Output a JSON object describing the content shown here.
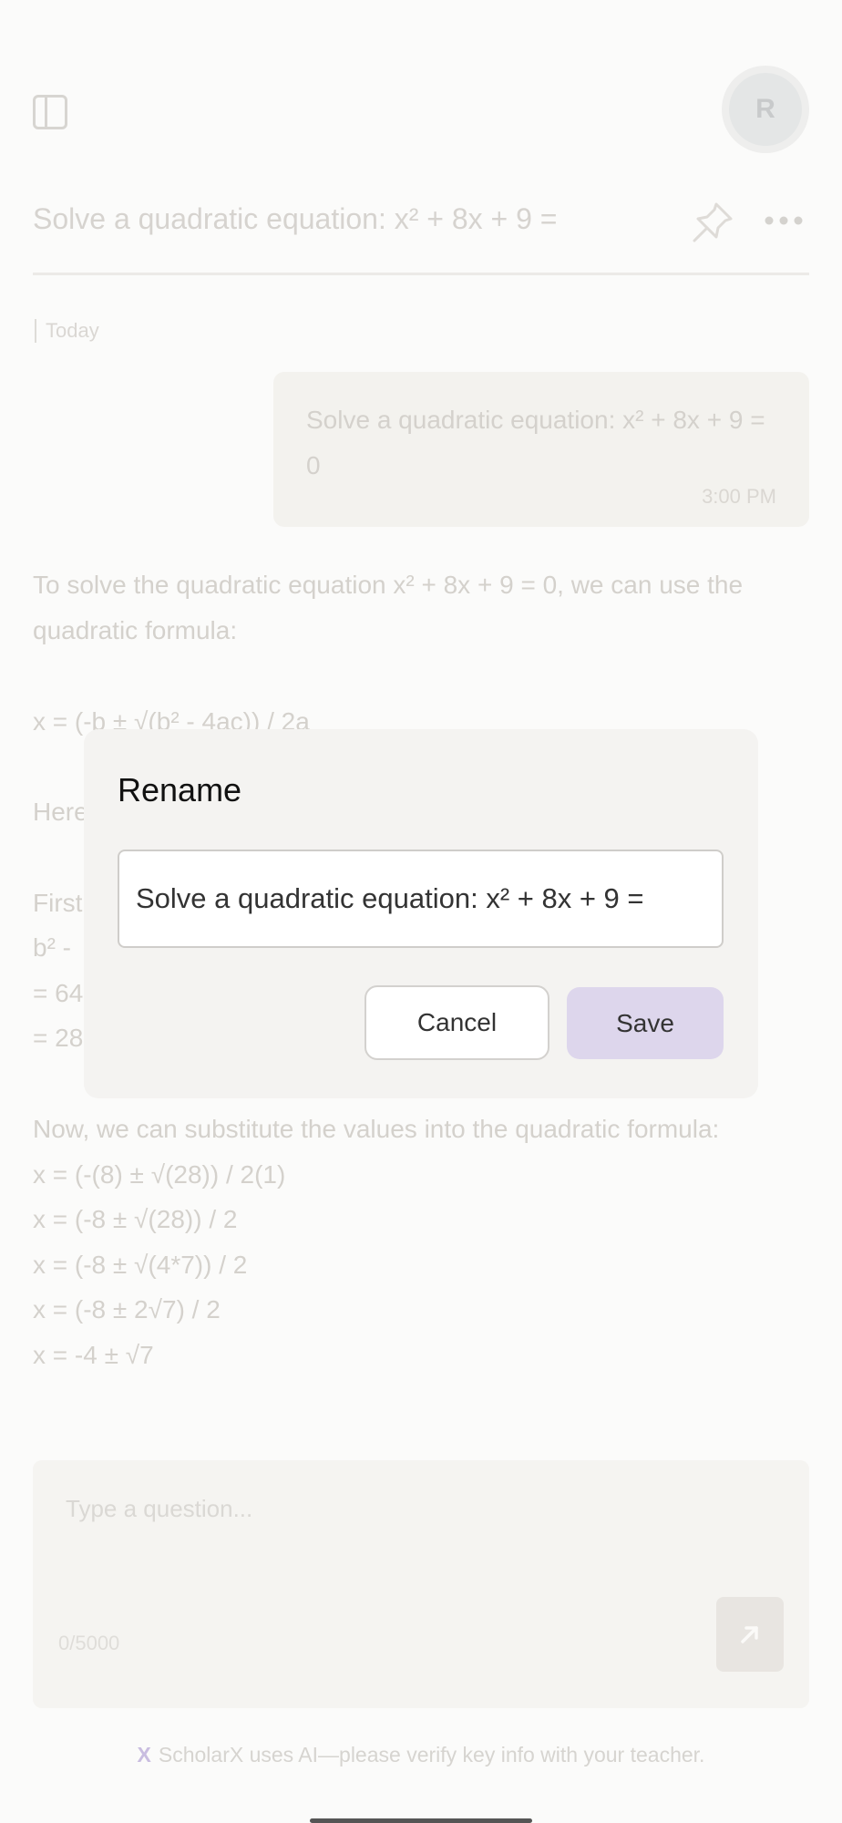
{
  "header": {
    "avatar_initial": "R",
    "chat_title": "Solve a quadratic equation: x² + 8x + 9 ="
  },
  "conversation": {
    "date_label": "Today",
    "user_message": {
      "text": "Solve a quadratic equation: x² + 8x + 9 = 0",
      "time": "3:00 PM"
    },
    "answer_lines": [
      "To solve the quadratic equation x² + 8x + 9 = 0, we can use the",
      "quadratic formula:",
      "x = (-b ± √(b² - 4ac)) / 2a",
      "Here",
      "First",
      "b² -",
      "= 64",
      "= 28",
      "Now, we can substitute the values into the quadratic formula:",
      "x = (-(8) ± √(28)) / 2(1)",
      "x = (-8 ± √(28)) / 2",
      "x = (-8 ± √(4*7)) / 2",
      "x = (-8 ± 2√7) / 2",
      "x = -4 ± √7"
    ]
  },
  "composer": {
    "placeholder": "Type a question...",
    "counter": "0/5000"
  },
  "footer": {
    "logo_mark": "X",
    "disclaimer": "ScholarX uses AI—please verify key info with your teacher."
  },
  "dialog": {
    "title": "Rename",
    "input_value": "Solve a quadratic equation: x² + 8x + 9 =",
    "cancel_label": "Cancel",
    "save_label": "Save"
  },
  "colors": {
    "save_button_bg": "#ddd6ec",
    "overlay_bg": "#fbfbfa"
  }
}
